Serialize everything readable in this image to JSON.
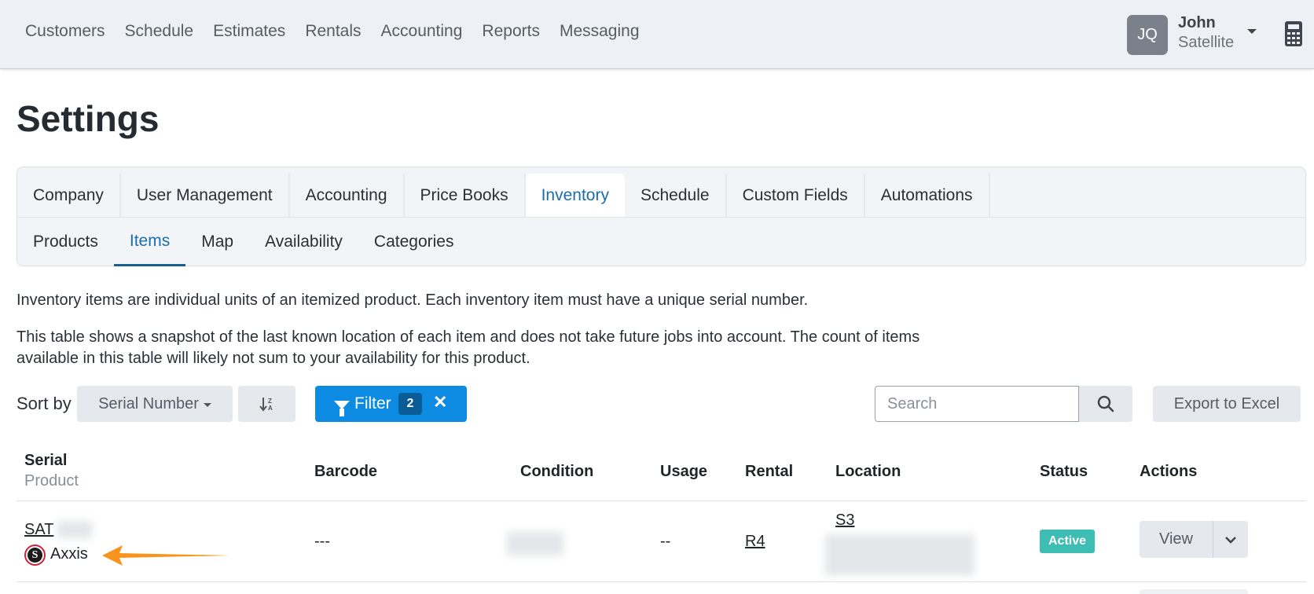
{
  "topnav": {
    "items": [
      "Customers",
      "Schedule",
      "Estimates",
      "Rentals",
      "Accounting",
      "Reports",
      "Messaging"
    ],
    "user": {
      "initials": "JQ",
      "name": "John",
      "org": "Satellite"
    },
    "calculator_icon": "calculator-icon"
  },
  "page": {
    "title": "Settings"
  },
  "tabs": {
    "main": [
      "Company",
      "User Management",
      "Accounting",
      "Price Books",
      "Inventory",
      "Schedule",
      "Custom Fields",
      "Automations"
    ],
    "main_active": "Inventory",
    "sub": [
      "Products",
      "Items",
      "Map",
      "Availability",
      "Categories"
    ],
    "sub_active": "Items"
  },
  "description": {
    "line1": "Inventory items are individual units of an itemized product. Each inventory item must have a unique serial number.",
    "line2a": "This table shows a snapshot of the last known location of each item and does not take future jobs into account. The count of items",
    "line2b": "available in this table will likely not sum to your availability for this product."
  },
  "toolbar": {
    "sort_label": "Sort by",
    "sort_value": "Serial Number",
    "filter_label": "Filter",
    "filter_count": "2",
    "filter_clear": "✕",
    "search_placeholder": "Search",
    "export_label": "Export to Excel"
  },
  "table": {
    "headers": {
      "serial": "Serial",
      "product": "Product",
      "barcode": "Barcode",
      "condition": "Condition",
      "usage": "Usage",
      "rental": "Rental",
      "location": "Location",
      "status": "Status",
      "actions": "Actions"
    },
    "rows": [
      {
        "serial": "SAT",
        "product": "Axxis",
        "barcode": "---",
        "usage": "--",
        "rental": "R4",
        "location": "S3",
        "status": "Active",
        "action_label": "View"
      }
    ]
  },
  "colors": {
    "accent": "#0d8be3",
    "link": "#1a6ea8",
    "status_active": "#3dbdb4",
    "annotation_arrow": "#f7941d"
  }
}
